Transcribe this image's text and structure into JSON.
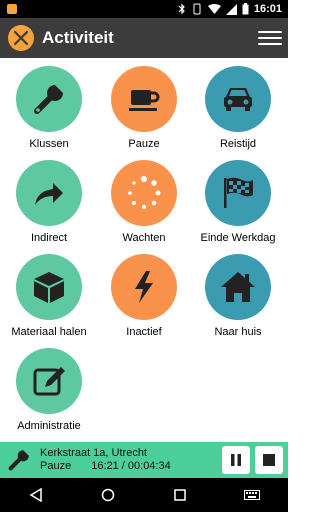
{
  "status_bar": {
    "time": "16:01"
  },
  "app_bar": {
    "title": "Activiteit"
  },
  "tiles": [
    {
      "label": "Klussen",
      "icon": "wrench-icon",
      "color": "#5ec9a1"
    },
    {
      "label": "Pauze",
      "icon": "coffee-cup-icon",
      "color": "#f9924a"
    },
    {
      "label": "Reistijd",
      "icon": "car-icon",
      "color": "#3b9bb0"
    },
    {
      "label": "Indirect",
      "icon": "share-arrow-icon",
      "color": "#5ec9a1"
    },
    {
      "label": "Wachten",
      "icon": "loading-dots-icon",
      "color": "#f9924a"
    },
    {
      "label": "Einde Werkdag",
      "icon": "finish-flag-icon",
      "color": "#3b9bb0"
    },
    {
      "label": "Materiaal halen",
      "icon": "box-icon",
      "color": "#5ec9a1"
    },
    {
      "label": "Inactief",
      "icon": "lightning-icon",
      "color": "#f9924a"
    },
    {
      "label": "Naar huis",
      "icon": "home-icon",
      "color": "#3b9bb0"
    },
    {
      "label": "Administratie",
      "icon": "edit-icon",
      "color": "#5ec9a1"
    }
  ],
  "bottom_panel": {
    "address": "Kerkstraat 1a, Utrecht",
    "activity": "Pauze",
    "time_info": "16:21 / 00:04:34",
    "color": "#4ccf9a"
  }
}
